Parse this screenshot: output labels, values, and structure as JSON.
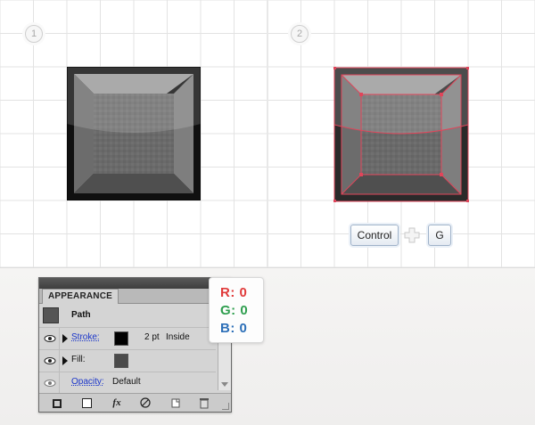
{
  "steps": [
    "1",
    "2"
  ],
  "shortcut": {
    "key1": "Control",
    "key2": "G"
  },
  "appearance": {
    "tab_label": "APPEARANCE",
    "object": "Path",
    "stroke": {
      "label": "Stroke:",
      "weight": "2 pt",
      "align": "Inside",
      "color": "#000000"
    },
    "fill": {
      "label": "Fill:",
      "color": "#4a4a4a"
    },
    "opacity": {
      "label": "Opacity:",
      "value": "Default"
    },
    "footer_icons": [
      "new-stroke-icon",
      "new-fill-icon",
      "fx-icon",
      "clear-appearance-icon",
      "duplicate-item-icon",
      "delete-item-icon"
    ],
    "fx_label": "fx"
  },
  "color_values": {
    "r": "R: 0",
    "g": "G: 0",
    "b": "B: 0",
    "r_color": "#e03a3a",
    "g_color": "#2e9e4e",
    "b_color": "#2c6fb8"
  }
}
